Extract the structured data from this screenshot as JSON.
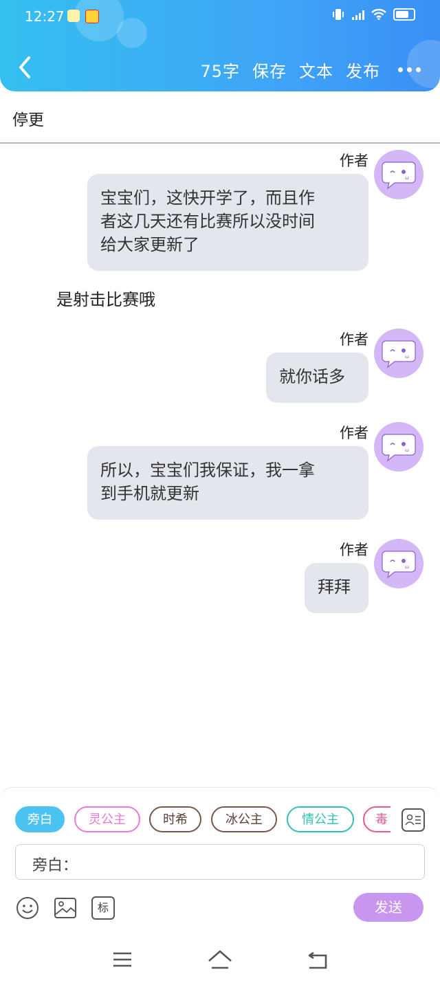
{
  "status_bar": {
    "time": "12:27"
  },
  "header": {
    "word_count": "75字",
    "save_label": "保存",
    "text_label": "文本",
    "publish_label": "发布"
  },
  "title": "停更",
  "messages": [
    {
      "author": "作者",
      "text_lines": [
        "宝宝们，这快开学了，而且作",
        "者这几天还有比赛所以没时间",
        "给大家更新了"
      ]
    },
    {
      "narration": "是射击比赛哦"
    },
    {
      "author": "作者",
      "text_lines": [
        "就你话多"
      ]
    },
    {
      "author": "作者",
      "text_lines": [
        "所以，宝宝们我保证，我一拿",
        "到手机就更新"
      ]
    },
    {
      "author": "作者",
      "text_lines": [
        "拜拜"
      ]
    }
  ],
  "composer": {
    "roles": [
      {
        "label": "旁白",
        "color": "#4cc3f0",
        "selected": true
      },
      {
        "label": "灵公主",
        "color": "#e879d6",
        "selected": false
      },
      {
        "label": "时希",
        "color": "#7a5548",
        "selected": false
      },
      {
        "label": "冰公主",
        "color": "#7a5548",
        "selected": false
      },
      {
        "label": "情公主",
        "color": "#2fc1b3",
        "selected": false
      },
      {
        "label": "毒",
        "color": "#e8598c",
        "selected": false
      }
    ],
    "input_label": "旁白：",
    "send_label": "发送",
    "tools": [
      "emoji-icon",
      "image-icon",
      "tag-icon"
    ],
    "tag_icon_text": "标"
  },
  "colors": {
    "header_start": "#35bff0",
    "header_end": "#3b8ff5",
    "bubble_bg": "#e3e6ed",
    "avatar_bg": "#d3b7f6",
    "send_bg": "#c896ee"
  }
}
